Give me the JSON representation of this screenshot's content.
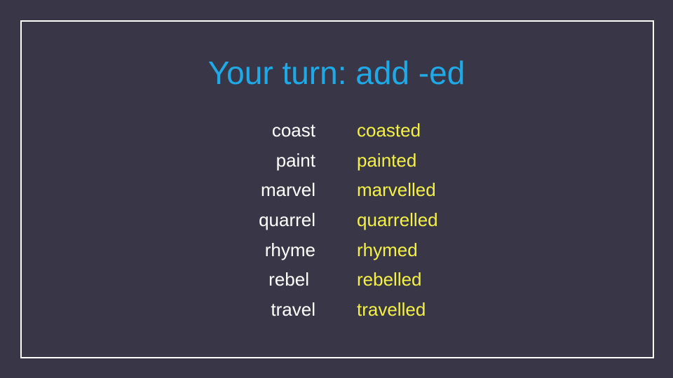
{
  "slide": {
    "title": "Your turn: add -ed",
    "colors": {
      "background": "#393747",
      "title": "#1fa9e6",
      "base_word": "#ffffff",
      "past_word": "#f3f046",
      "border": "#ffffff"
    },
    "rows": [
      {
        "base": "coast",
        "past": "coasted"
      },
      {
        "base": "paint",
        "past": "painted"
      },
      {
        "base": "marvel",
        "past": "marvelled"
      },
      {
        "base": "quarrel",
        "past": "quarrelled"
      },
      {
        "base": "rhyme",
        "past": "rhymed"
      },
      {
        "base": "rebel ",
        "past": "rebelled"
      },
      {
        "base": "travel",
        "past": "travelled"
      }
    ]
  }
}
